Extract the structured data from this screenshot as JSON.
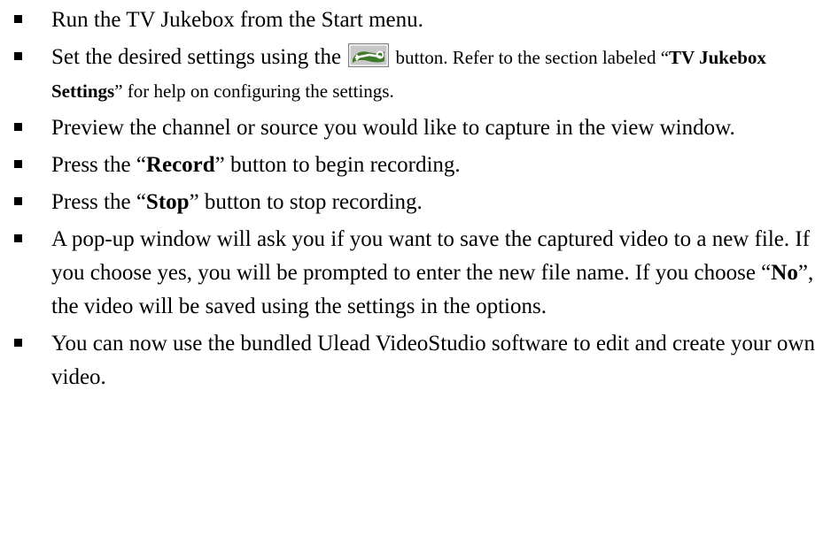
{
  "steps": [
    {
      "text": "Run the TV Jukebox from the Start menu."
    },
    {
      "before_icon": "Set the desired settings using the ",
      "icon": "settings-wrench-button-icon",
      "after_icon": " button. Refer to the section labeled “",
      "bold": "TV Jukebox Settings",
      "after_bold": "” for help on configuring the settings."
    },
    {
      "text": "Preview the channel or source you would like to capture in the view window."
    },
    {
      "before": "Press the “",
      "bold": "Record",
      "after": "” button to begin recording."
    },
    {
      "before": "Press the “",
      "bold": "Stop",
      "after": "” button to stop recording."
    },
    {
      "before": "A pop-up window will ask you if you want to save the captured video to a new file. If you choose yes, you will be prompted to enter the new file name. If you choose “",
      "bold": "No",
      "after": "”, the video will be saved using the settings in the options."
    },
    {
      "text": "You can now use the bundled Ulead VideoStudio software to edit and create your own video."
    }
  ],
  "colors": {
    "text": "#000000",
    "background": "#ffffff",
    "icon_fill": "#5a9a3a",
    "icon_frame": "#808080"
  }
}
